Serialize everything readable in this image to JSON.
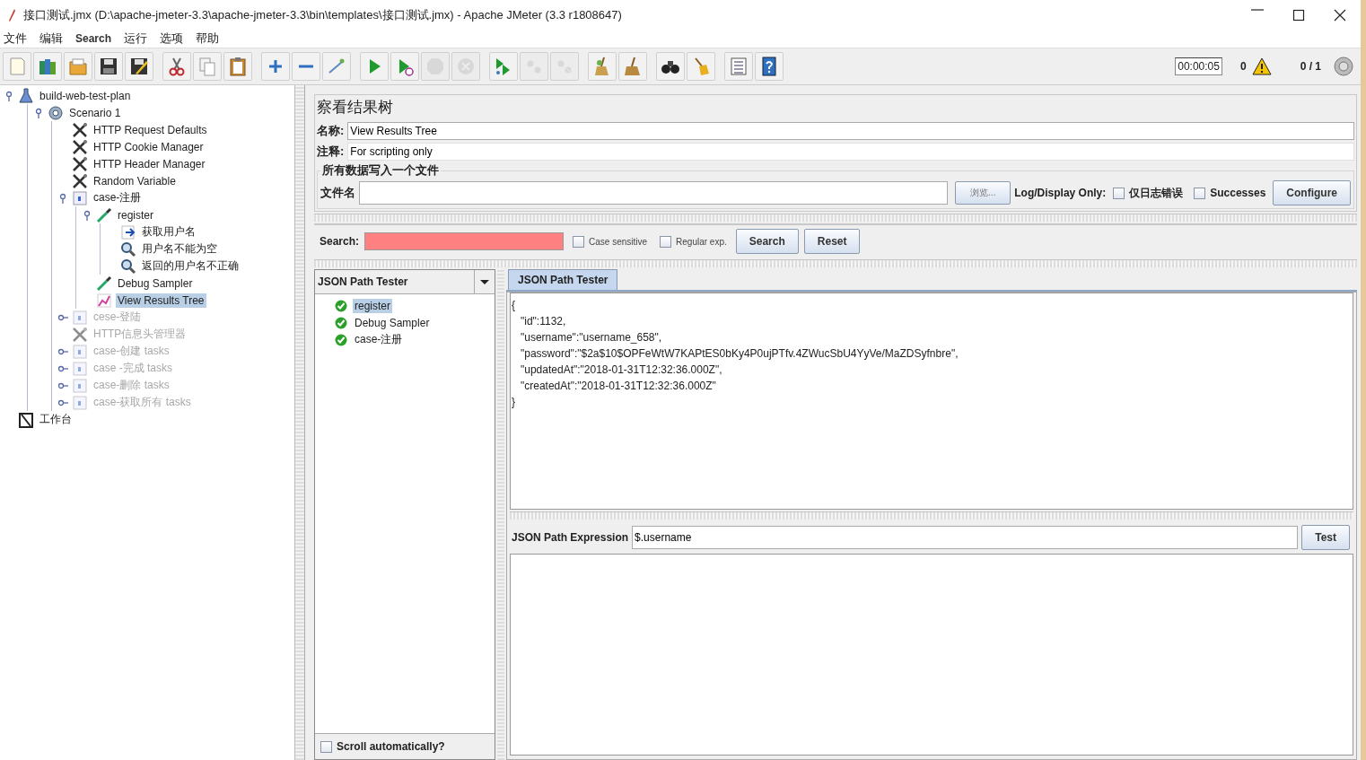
{
  "window": {
    "title": "接口测试.jmx (D:\\apache-jmeter-3.3\\apache-jmeter-3.3\\bin\\templates\\接口测试.jmx) - Apache JMeter (3.3 r1808647)"
  },
  "menu": [
    "文件",
    "编辑",
    "Search",
    "运行",
    "选项",
    "帮助"
  ],
  "toolbar": [
    {
      "kind": "new",
      "disabled": false
    },
    {
      "kind": "templates",
      "disabled": false
    },
    {
      "kind": "open",
      "disabled": false
    },
    {
      "kind": "save",
      "disabled": false
    },
    {
      "kind": "save-as",
      "disabled": false
    },
    {
      "kind": "separator"
    },
    {
      "kind": "cut",
      "disabled": false
    },
    {
      "kind": "copy",
      "disabled": false
    },
    {
      "kind": "paste",
      "disabled": false
    },
    {
      "kind": "separator"
    },
    {
      "kind": "expand",
      "disabled": false
    },
    {
      "kind": "collapse",
      "disabled": false
    },
    {
      "kind": "toggle",
      "disabled": false
    },
    {
      "kind": "separator"
    },
    {
      "kind": "start",
      "disabled": false
    },
    {
      "kind": "start-no-timers",
      "disabled": false
    },
    {
      "kind": "stop",
      "disabled": true
    },
    {
      "kind": "shutdown",
      "disabled": true
    },
    {
      "kind": "separator"
    },
    {
      "kind": "remote-start",
      "disabled": false
    },
    {
      "kind": "remote-stop",
      "disabled": true
    },
    {
      "kind": "remote-shutdown",
      "disabled": true
    },
    {
      "kind": "separator"
    },
    {
      "kind": "clear",
      "disabled": false
    },
    {
      "kind": "clear-all",
      "disabled": false
    },
    {
      "kind": "separator"
    },
    {
      "kind": "search",
      "disabled": false
    },
    {
      "kind": "reset-search",
      "disabled": false
    },
    {
      "kind": "separator"
    },
    {
      "kind": "functions",
      "disabled": false
    },
    {
      "kind": "help",
      "disabled": false
    }
  ],
  "status": {
    "timer": "00:00:05",
    "warnings": "0",
    "threads": "0 / 1"
  },
  "tree": [
    {
      "label": "build-web-test-plan",
      "kind": "plan",
      "enabled": true,
      "selected": false,
      "expanded": true,
      "children": [
        {
          "label": "Scenario 1",
          "kind": "thread-group",
          "enabled": true,
          "selected": false,
          "expanded": true,
          "children": [
            {
              "label": "HTTP Request Defaults",
              "kind": "config",
              "enabled": true,
              "selected": false
            },
            {
              "label": "HTTP Cookie Manager",
              "kind": "config",
              "enabled": true,
              "selected": false
            },
            {
              "label": "HTTP Header Manager",
              "kind": "config",
              "enabled": true,
              "selected": false
            },
            {
              "label": "Random Variable",
              "kind": "config",
              "enabled": true,
              "selected": false
            },
            {
              "label": "case-注册",
              "kind": "controller",
              "enabled": true,
              "selected": false,
              "expanded": true,
              "children": [
                {
                  "label": "register",
                  "kind": "sampler",
                  "enabled": true,
                  "selected": false,
                  "expanded": true,
                  "children": [
                    {
                      "label": "获取用户名",
                      "kind": "extractor",
                      "enabled": true,
                      "selected": false
                    },
                    {
                      "label": "用户名不能为空",
                      "kind": "assertion",
                      "enabled": true,
                      "selected": false
                    },
                    {
                      "label": "返回的用户名不正确",
                      "kind": "assertion",
                      "enabled": true,
                      "selected": false
                    }
                  ]
                },
                {
                  "label": "Debug Sampler",
                  "kind": "sampler",
                  "enabled": true,
                  "selected": false
                },
                {
                  "label": "View Results Tree",
                  "kind": "listener",
                  "enabled": true,
                  "selected": true
                }
              ]
            },
            {
              "label": "cese-登陆",
              "kind": "controller",
              "enabled": false,
              "selected": false,
              "expanded": false
            },
            {
              "label": "HTTP信息头管理器",
              "kind": "config",
              "enabled": false,
              "selected": false
            },
            {
              "label": "case-创建 tasks",
              "kind": "controller",
              "enabled": false,
              "selected": false,
              "expanded": false
            },
            {
              "label": "case -完成 tasks",
              "kind": "controller",
              "enabled": false,
              "selected": false,
              "expanded": false
            },
            {
              "label": "case-删除 tasks",
              "kind": "controller",
              "enabled": false,
              "selected": false,
              "expanded": false
            },
            {
              "label": "case-获取所有 tasks",
              "kind": "controller",
              "enabled": false,
              "selected": false,
              "expanded": false
            }
          ]
        }
      ]
    },
    {
      "label": "工作台",
      "kind": "workbench",
      "enabled": true,
      "selected": false
    }
  ],
  "panel": {
    "title": "察看结果树",
    "name": {
      "label": "名称:",
      "value": "View Results Tree"
    },
    "comments": {
      "label": "注释:",
      "value": "For scripting only"
    },
    "file_group": {
      "legend": "所有数据写入一个文件",
      "file_label": "文件名",
      "browse": "浏览...",
      "log_label": "Log/Display Only:",
      "options": [
        {
          "label": "仅日志错误",
          "checked": false
        },
        {
          "label": "Successes",
          "checked": false
        }
      ],
      "configure": "Configure"
    }
  },
  "search": {
    "label": "Search:",
    "no_match": true,
    "options": [
      {
        "label": "Case sensitive",
        "checked": false
      },
      {
        "label": "Regular exp.",
        "checked": false
      }
    ],
    "buttons": [
      "Search",
      "Reset"
    ]
  },
  "renderer": "JSON Path Tester",
  "results": [
    {
      "label": "register",
      "selected": true,
      "success": true
    },
    {
      "label": "Debug Sampler",
      "selected": false,
      "success": true
    },
    {
      "label": "case-注册",
      "selected": false,
      "success": true
    }
  ],
  "tabs": [
    {
      "label": "JSON Path Tester",
      "selected": true
    }
  ],
  "response": "{\n   \"id\":1132,\n   \"username\":\"username_658\",\n   \"password\":\"$2a$10$OPFeWtW7KAPtES0bKy4P0ujPTfv.4ZWucSbU4YyVe/MaZDSyfnbre\",\n   \"updatedAt\":\"2018-01-31T12:32:36.000Z\",\n   \"createdAt\":\"2018-01-31T12:32:36.000Z\"\n}",
  "expression": {
    "label": "JSON Path Expression",
    "value": "$.username",
    "button": "Test"
  },
  "scroll_auto": {
    "label": "Scroll automatically?",
    "checked": false
  }
}
